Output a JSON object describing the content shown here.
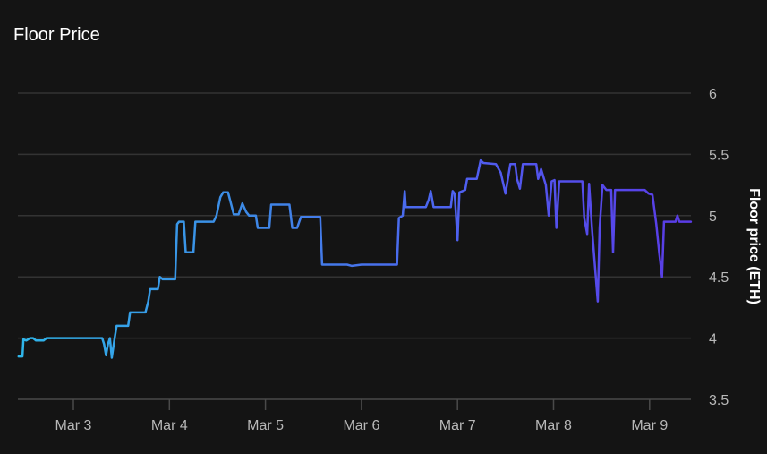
{
  "title": "Floor Price",
  "chart_data": {
    "type": "line",
    "title": "Floor Price",
    "xlabel": "",
    "ylabel": "Floor price (ETH)",
    "y_axis_side": "right",
    "ylim": [
      3.5,
      6.2
    ],
    "yticks": [
      3.5,
      4,
      4.5,
      5,
      5.5,
      6
    ],
    "ytick_labels": [
      "3.5",
      "4",
      "4.5",
      "5",
      "5.5",
      "6"
    ],
    "x_unit": "days since Mar 3",
    "xlim": [
      -0.58,
      6.43
    ],
    "xticks": [
      0,
      1,
      2,
      3,
      4,
      5,
      6
    ],
    "xtick_labels": [
      "Mar 3",
      "Mar 4",
      "Mar 5",
      "Mar 6",
      "Mar 7",
      "Mar 8",
      "Mar 9"
    ],
    "grid": true,
    "legend": "none",
    "line_gradient": [
      "#2fb6ea",
      "#3d8ae6",
      "#4f5ff0",
      "#5a3be6"
    ],
    "series": [
      {
        "name": "Floor price",
        "points": [
          [
            -0.57,
            3.85
          ],
          [
            -0.53,
            3.85
          ],
          [
            -0.52,
            3.99
          ],
          [
            -0.49,
            3.98
          ],
          [
            -0.45,
            4.0
          ],
          [
            -0.42,
            4.0
          ],
          [
            -0.39,
            3.98
          ],
          [
            -0.31,
            3.98
          ],
          [
            -0.28,
            4.0
          ],
          [
            0.0,
            4.0
          ],
          [
            0.3,
            4.0
          ],
          [
            0.32,
            3.95
          ],
          [
            0.34,
            3.86
          ],
          [
            0.36,
            3.95
          ],
          [
            0.38,
            4.0
          ],
          [
            0.4,
            3.84
          ],
          [
            0.43,
            4.0
          ],
          [
            0.45,
            4.1
          ],
          [
            0.57,
            4.1
          ],
          [
            0.59,
            4.21
          ],
          [
            0.75,
            4.21
          ],
          [
            0.78,
            4.3
          ],
          [
            0.8,
            4.4
          ],
          [
            0.88,
            4.4
          ],
          [
            0.9,
            4.5
          ],
          [
            0.93,
            4.48
          ],
          [
            1.06,
            4.48
          ],
          [
            1.08,
            4.93
          ],
          [
            1.1,
            4.95
          ],
          [
            1.15,
            4.95
          ],
          [
            1.17,
            4.7
          ],
          [
            1.25,
            4.7
          ],
          [
            1.27,
            4.95
          ],
          [
            1.46,
            4.95
          ],
          [
            1.49,
            5.0
          ],
          [
            1.53,
            5.15
          ],
          [
            1.56,
            5.19
          ],
          [
            1.61,
            5.19
          ],
          [
            1.64,
            5.1
          ],
          [
            1.67,
            5.01
          ],
          [
            1.72,
            5.01
          ],
          [
            1.76,
            5.1
          ],
          [
            1.8,
            5.03
          ],
          [
            1.83,
            5.0
          ],
          [
            1.9,
            5.0
          ],
          [
            1.92,
            4.9
          ],
          [
            2.04,
            4.9
          ],
          [
            2.06,
            5.09
          ],
          [
            2.25,
            5.09
          ],
          [
            2.28,
            4.9
          ],
          [
            2.33,
            4.9
          ],
          [
            2.37,
            4.99
          ],
          [
            2.57,
            4.99
          ],
          [
            2.59,
            4.6
          ],
          [
            2.85,
            4.6
          ],
          [
            2.9,
            4.59
          ],
          [
            3.0,
            4.6
          ],
          [
            3.37,
            4.6
          ],
          [
            3.39,
            4.98
          ],
          [
            3.43,
            5.0
          ],
          [
            3.45,
            5.2
          ],
          [
            3.46,
            5.07
          ],
          [
            3.67,
            5.07
          ],
          [
            3.7,
            5.13
          ],
          [
            3.72,
            5.2
          ],
          [
            3.75,
            5.07
          ],
          [
            3.93,
            5.07
          ],
          [
            3.95,
            5.2
          ],
          [
            3.97,
            5.18
          ],
          [
            4.0,
            4.8
          ],
          [
            4.02,
            5.19
          ],
          [
            4.08,
            5.21
          ],
          [
            4.1,
            5.3
          ],
          [
            4.2,
            5.3
          ],
          [
            4.24,
            5.45
          ],
          [
            4.27,
            5.43
          ],
          [
            4.4,
            5.42
          ],
          [
            4.45,
            5.35
          ],
          [
            4.5,
            5.18
          ],
          [
            4.55,
            5.42
          ],
          [
            4.6,
            5.42
          ],
          [
            4.62,
            5.3
          ],
          [
            4.65,
            5.22
          ],
          [
            4.68,
            5.42
          ],
          [
            4.82,
            5.42
          ],
          [
            4.84,
            5.3
          ],
          [
            4.87,
            5.38
          ],
          [
            4.92,
            5.25
          ],
          [
            4.95,
            5.0
          ],
          [
            4.98,
            5.28
          ],
          [
            5.01,
            5.29
          ],
          [
            5.03,
            4.9
          ],
          [
            5.06,
            5.28
          ],
          [
            5.3,
            5.28
          ],
          [
            5.32,
            4.98
          ],
          [
            5.35,
            4.85
          ],
          [
            5.37,
            5.26
          ],
          [
            5.4,
            4.9
          ],
          [
            5.43,
            4.6
          ],
          [
            5.46,
            4.3
          ],
          [
            5.48,
            4.9
          ],
          [
            5.51,
            5.25
          ],
          [
            5.55,
            5.21
          ],
          [
            5.57,
            5.21
          ],
          [
            5.6,
            5.21
          ],
          [
            5.62,
            4.7
          ],
          [
            5.64,
            5.21
          ],
          [
            5.95,
            5.21
          ],
          [
            5.99,
            5.18
          ],
          [
            6.03,
            5.17
          ],
          [
            6.07,
            4.93
          ],
          [
            6.1,
            4.7
          ],
          [
            6.13,
            4.5
          ],
          [
            6.15,
            4.95
          ],
          [
            6.27,
            4.95
          ],
          [
            6.29,
            5.0
          ],
          [
            6.31,
            4.95
          ],
          [
            6.43,
            4.95
          ]
        ]
      }
    ]
  }
}
